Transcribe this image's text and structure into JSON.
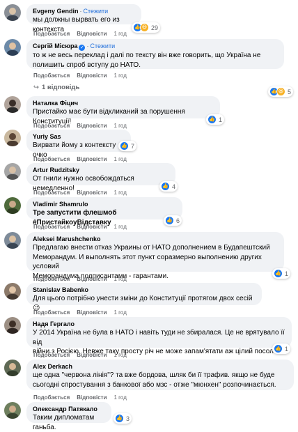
{
  "ui": {
    "like_label": "Подобається",
    "reply_label": "Відповісти",
    "follow_label": "Стежити"
  },
  "comments": [
    {
      "author": "Evgeny Gendin",
      "follow": true,
      "verified": false,
      "lines": [
        "мы должны вырвать его из контекста"
      ],
      "reactions": [
        "like",
        "haha"
      ],
      "count": "29",
      "time": "1 год"
    },
    {
      "author": "Сергій Місюра",
      "follow": true,
      "verified": true,
      "lines": [
        "то ж не весь переклад і далі по тексту він вже говорить, що Україна не",
        "полишить спроб вступу до НАТО."
      ],
      "reactions": [
        "like",
        "haha"
      ],
      "count": "5",
      "time": "1 год",
      "replies": "1 відповідь"
    },
    {
      "author": "Наталка Фіцич",
      "follow": false,
      "verified": false,
      "lines": [
        "Пристайко має бути відкликаний за порушення Конституції!"
      ],
      "reactions": [
        "like"
      ],
      "count": "1",
      "time": "1 год"
    },
    {
      "author": "Yuriy Sas",
      "follow": false,
      "verified": false,
      "lines": [
        "Вирвати йому з контексту очко"
      ],
      "reactions": [
        "like"
      ],
      "count": "7",
      "time": "1 год"
    },
    {
      "author": "Artur Rudzitsky",
      "follow": false,
      "verified": false,
      "lines": [
        "От гнили нужно освобождаться немедленно!"
      ],
      "reactions": [
        "like"
      ],
      "count": "4",
      "time": "1 год"
    },
    {
      "author": "Vladimir Shamrulo",
      "follow": false,
      "verified": false,
      "lines": [
        "Тре запустити флешмоб #ПристайкоуВідставку"
      ],
      "bold_tail": "#ПристайкоуВідставку",
      "reactions": [
        "like"
      ],
      "count": "6",
      "time": "1 год"
    },
    {
      "author": "Aleksei Marushchenko",
      "follow": false,
      "verified": false,
      "lines": [
        "Предлагаю внести отказ Украины от НАТО дополнением в Будапештский",
        "Меморандум. И выполнять этот пункт соразмерно выполнению других условий",
        "Меморандума подписантами - гарантами."
      ],
      "reactions": [
        "like"
      ],
      "count": "1",
      "time": "1 год"
    },
    {
      "author": "Stanislav Babenko",
      "follow": false,
      "verified": false,
      "lines": [
        "Для цього потрібно унести зміни до Конституції протягом двох сесій 😉"
      ],
      "reactions": [],
      "count": "",
      "time": "1 год"
    },
    {
      "author": "Надя Гергало",
      "follow": false,
      "verified": false,
      "lines": [
        "У 2014 Україна не була в НАТО і навіть туди не збиралася. Це не врятувало її від",
        "війни з Росією. Невже таку просту річ не може запам'ятати аж цілий посол?"
      ],
      "reactions": [
        "like"
      ],
      "count": "1",
      "time": "1 год"
    },
    {
      "author": "Alex Derkach",
      "follow": false,
      "verified": false,
      "lines": [
        "ще одна \"червона лінія\"? та вже бордова, шляк би її трафив. якщо не буде",
        "сьогодні спростування з банкової або мзс - отже \"мюнхен\" розпочинається."
      ],
      "reactions": [],
      "count": "",
      "time": "1 год"
    },
    {
      "author": "Олександр Патякало",
      "follow": false,
      "verified": false,
      "lines": [
        "Таким дипломатам ганьба."
      ],
      "reactions": [
        "like"
      ],
      "count": "3",
      "time": ""
    }
  ]
}
